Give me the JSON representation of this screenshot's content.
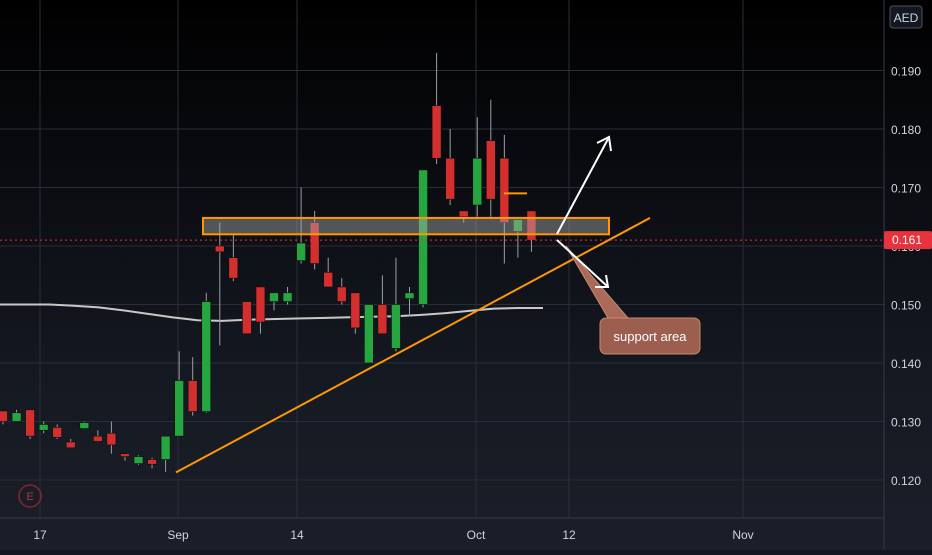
{
  "chart_data": {
    "type": "candlestick",
    "currency_label": "AED",
    "y_axis_ticks": [
      0.12,
      0.13,
      0.14,
      0.15,
      0.16,
      0.17,
      0.18,
      0.19
    ],
    "y_tick_labels": [
      "0.120",
      "0.130",
      "0.140",
      "0.150",
      "0.160",
      "0.170",
      "0.180",
      "0.190"
    ],
    "ylim": [
      0.113,
      0.2
    ],
    "x_axis_labels": [
      "17",
      "Sep",
      "14",
      "Oct",
      "12",
      "Nov"
    ],
    "last_price_label": "0.161",
    "last_price": 0.161,
    "up_color": "#26a641",
    "down_color": "#d32f2f",
    "last_price_color": "#e8323e",
    "ma_color": "#c8c8c8",
    "trendline_color": "#ff9800",
    "candles": [
      {
        "o": 0.1318,
        "h": 0.1318,
        "l": 0.1295,
        "c": 0.13
      },
      {
        "o": 0.13,
        "h": 0.132,
        "l": 0.13,
        "c": 0.1315
      },
      {
        "o": 0.132,
        "h": 0.132,
        "l": 0.127,
        "c": 0.1275
      },
      {
        "o": 0.1285,
        "h": 0.13,
        "l": 0.128,
        "c": 0.1295
      },
      {
        "o": 0.129,
        "h": 0.1295,
        "l": 0.127,
        "c": 0.1273
      },
      {
        "o": 0.1265,
        "h": 0.127,
        "l": 0.1255,
        "c": 0.1255
      },
      {
        "o": 0.1288,
        "h": 0.13,
        "l": 0.1287,
        "c": 0.1298
      },
      {
        "o": 0.1275,
        "h": 0.1285,
        "l": 0.1265,
        "c": 0.1266
      },
      {
        "o": 0.128,
        "h": 0.13,
        "l": 0.1245,
        "c": 0.126
      },
      {
        "o": 0.1245,
        "h": 0.1245,
        "l": 0.1233,
        "c": 0.124
      },
      {
        "o": 0.1228,
        "h": 0.1242,
        "l": 0.1226,
        "c": 0.124
      },
      {
        "o": 0.1235,
        "h": 0.1238,
        "l": 0.122,
        "c": 0.1227
      },
      {
        "o": 0.1235,
        "h": 0.1275,
        "l": 0.1214,
        "c": 0.1275
      },
      {
        "o": 0.1275,
        "h": 0.142,
        "l": 0.1275,
        "c": 0.137
      },
      {
        "o": 0.137,
        "h": 0.141,
        "l": 0.131,
        "c": 0.1317
      },
      {
        "o": 0.1317,
        "h": 0.152,
        "l": 0.1315,
        "c": 0.1505
      },
      {
        "o": 0.16,
        "h": 0.164,
        "l": 0.143,
        "c": 0.159
      },
      {
        "o": 0.158,
        "h": 0.162,
        "l": 0.154,
        "c": 0.1545
      },
      {
        "o": 0.1505,
        "h": 0.1505,
        "l": 0.145,
        "c": 0.145
      },
      {
        "o": 0.153,
        "h": 0.153,
        "l": 0.145,
        "c": 0.147
      },
      {
        "o": 0.1505,
        "h": 0.152,
        "l": 0.149,
        "c": 0.152
      },
      {
        "o": 0.1505,
        "h": 0.153,
        "l": 0.15,
        "c": 0.152
      },
      {
        "o": 0.1575,
        "h": 0.17,
        "l": 0.157,
        "c": 0.1605
      },
      {
        "o": 0.164,
        "h": 0.166,
        "l": 0.156,
        "c": 0.157
      },
      {
        "o": 0.1555,
        "h": 0.158,
        "l": 0.153,
        "c": 0.153
      },
      {
        "o": 0.153,
        "h": 0.1545,
        "l": 0.15,
        "c": 0.1505
      },
      {
        "o": 0.152,
        "h": 0.152,
        "l": 0.145,
        "c": 0.146
      },
      {
        "o": 0.14,
        "h": 0.15,
        "l": 0.14,
        "c": 0.15
      },
      {
        "o": 0.15,
        "h": 0.155,
        "l": 0.145,
        "c": 0.145
      },
      {
        "o": 0.1425,
        "h": 0.158,
        "l": 0.142,
        "c": 0.15
      },
      {
        "o": 0.151,
        "h": 0.153,
        "l": 0.148,
        "c": 0.152
      },
      {
        "o": 0.15,
        "h": 0.16,
        "l": 0.1495,
        "c": 0.173
      },
      {
        "o": 0.184,
        "h": 0.193,
        "l": 0.174,
        "c": 0.175
      },
      {
        "o": 0.175,
        "h": 0.18,
        "l": 0.167,
        "c": 0.168
      },
      {
        "o": 0.166,
        "h": 0.166,
        "l": 0.164,
        "c": 0.165
      },
      {
        "o": 0.167,
        "h": 0.182,
        "l": 0.165,
        "c": 0.175
      },
      {
        "o": 0.178,
        "h": 0.185,
        "l": 0.165,
        "c": 0.168
      },
      {
        "o": 0.175,
        "h": 0.179,
        "l": 0.157,
        "c": 0.164
      },
      {
        "o": 0.1625,
        "h": 0.164,
        "l": 0.158,
        "c": 0.1645
      },
      {
        "o": 0.166,
        "h": 0.166,
        "l": 0.159,
        "c": 0.161
      }
    ],
    "moving_average": [
      0.15,
      0.15,
      0.15,
      0.1498,
      0.1495,
      0.149,
      0.1484,
      0.1478,
      0.1473,
      0.1472,
      0.1474,
      0.1475,
      0.1476,
      0.1477,
      0.1478,
      0.1479,
      0.148,
      0.1482,
      0.1485,
      0.1489,
      0.1493,
      0.1494,
      0.1494
    ],
    "support_area": {
      "low": 0.162,
      "high": 0.1648
    },
    "trendline": {
      "from": 0.1213,
      "to": 0.1648
    },
    "annotation": "support area",
    "earnings_marker": "E"
  }
}
